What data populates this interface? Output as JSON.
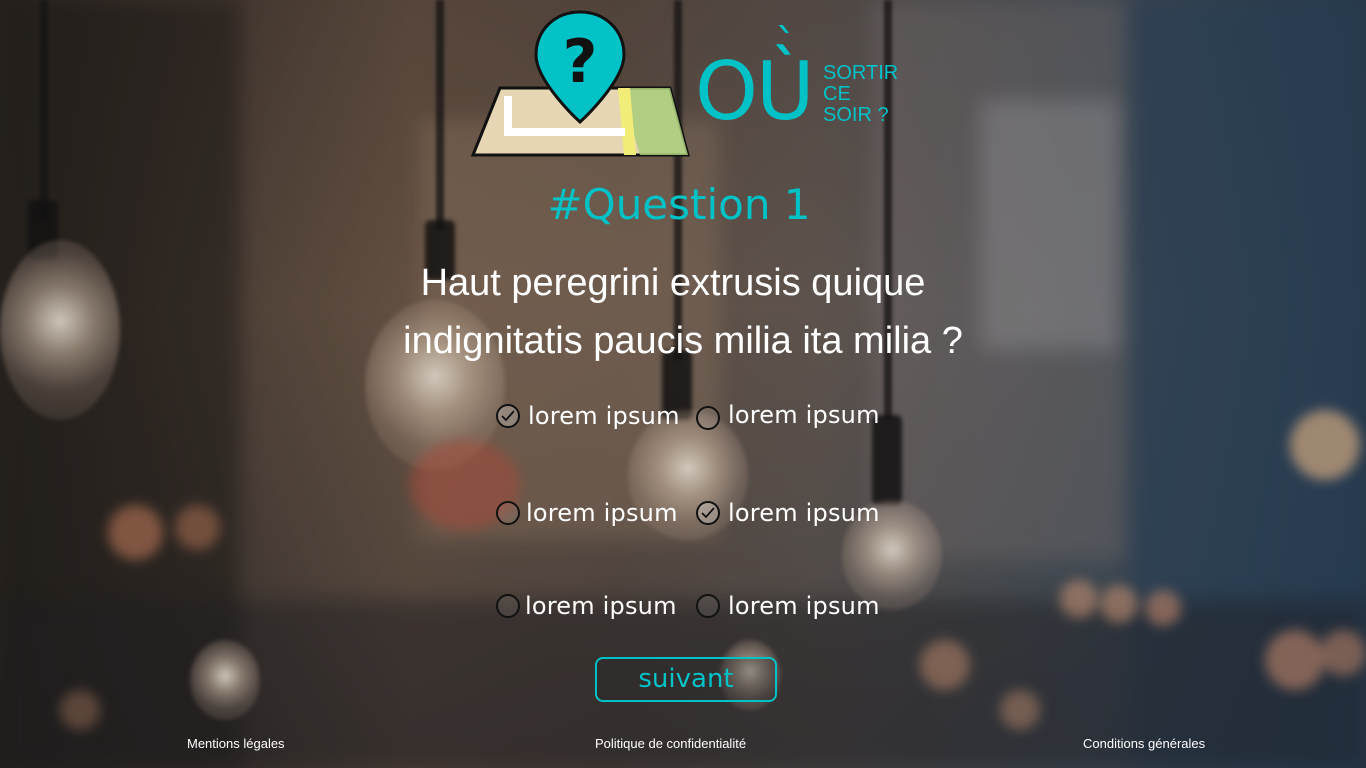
{
  "brand": {
    "name_big": "OÙ",
    "lines": [
      "SORTIR",
      "CE",
      "SOIR ?"
    ],
    "accent_color": "#00c2c7",
    "logo_icon": "map-pin-question-icon"
  },
  "question": {
    "number_label": "#Question 1",
    "text_line1": "Haut peregrini extrusis quique",
    "text_line2": "indignitatis  paucis milia ita milia ?"
  },
  "answers": [
    {
      "label": "lorem ipsum",
      "checked": true
    },
    {
      "label": "lorem ipsum",
      "checked": false
    },
    {
      "label": "lorem ipsum",
      "checked": false
    },
    {
      "label": "lorem ipsum",
      "checked": true
    },
    {
      "label": "lorem ipsum",
      "checked": false
    },
    {
      "label": "lorem ipsum",
      "checked": false
    }
  ],
  "next_button": {
    "label": "suivant"
  },
  "footer": {
    "legal": "Mentions légales",
    "privacy": "Politique de confidentialité",
    "terms": "Conditions générales"
  }
}
